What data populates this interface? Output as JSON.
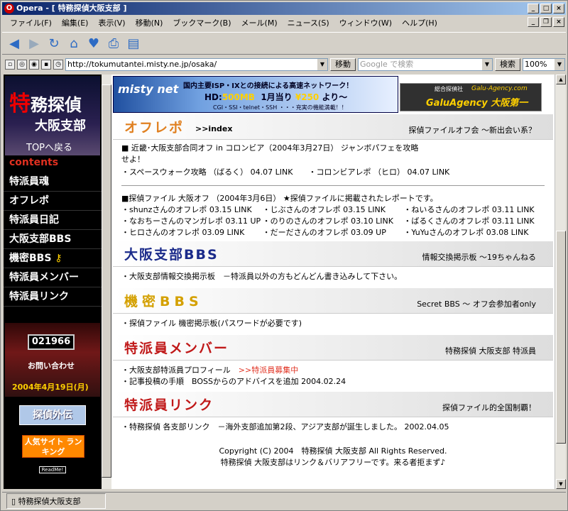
{
  "window": {
    "title": "Opera - [ 特務探偵大阪支部 ]"
  },
  "menu": [
    "ファイル(F)",
    "編集(E)",
    "表示(V)",
    "移動(N)",
    "ブックマーク(B)",
    "メール(M)",
    "ニュース(S)",
    "ウィンドウ(W)",
    "ヘルプ(H)"
  ],
  "address": {
    "url": "http://tokumutantei.misty.ne.jp/osaka/",
    "go_label": "移動",
    "search_placeholder": "Google で検索",
    "search_label": "検索",
    "zoom": "100%"
  },
  "status": {
    "text": "特務探偵大阪支部"
  },
  "sidebar": {
    "logo_big": "特",
    "logo_rest": "務探偵",
    "logo_sub": "大阪支部",
    "top_link": "TOPへ戻る",
    "contents_label": "contents",
    "items": [
      "特派員魂",
      "オフレポ",
      "特派員日記",
      "大阪支部BBS",
      "機密BBS",
      "特派員メンバー",
      "特派員リンク"
    ],
    "counter": "021966",
    "inquiry": "お問い合わせ",
    "date": "2004年4月19日(月)",
    "banner1": "探偵外伝",
    "banner2": "人気サイト ランキング",
    "readme": "ReadMe!"
  },
  "banners": {
    "misty": {
      "logo": "misty net",
      "line1": "国内主要ISP・IXとの接続による高速ネットワーク！",
      "line2a": "HD:",
      "line2b": "500MB",
      "line2c": "1月当り",
      "line2d": "¥250",
      "line2e": "より〜",
      "line3": "CGI・SSI・telnet・SSH ・・・充実の機能満載！！"
    },
    "galu": {
      "l1": "総合探偵社",
      "l2": "Galu-Agency.com",
      "l3": "GaluAgency 大阪第一"
    }
  },
  "sections": {
    "offrepo": {
      "title": "オフレポ",
      "sub": ">>index",
      "right": "探偵ファイルオフ会 〜新出会い系？",
      "p1": "■ 近畿･大阪支部合同オフ in コロンビア（2004年3月27日） ジャンボパフェを攻略せよ！",
      "p1_links": "・スペースウォーク攻略 （ばるく） 04.07 LINK　　・コロンビアレポ （ヒロ） 04.07 LINK",
      "p2": "■探偵ファイル 大阪オフ （2004年3月6日） ★探偵ファイルに掲載されたレポートです。",
      "reports": [
        [
          "・shunzさんのオフレポ 03.15 LINK",
          "・じぶさんのオフレポ 03.15 LINK",
          "・ねいるさんのオフレポ 03.11 LINK"
        ],
        [
          "・なおちーさんのマンガレポ 03.11 UP",
          "・のりのさんのオフレポ 03.10 LINK",
          "・ばるくさんのオフレポ 03.11 LINK"
        ],
        [
          "・ヒロさんのオフレポ 03.09 LINK",
          "・だーださんのオフレポ 03.09 UP",
          "・YuYuさんのオフレポ 03.08 LINK"
        ]
      ]
    },
    "bbs": {
      "title": "大阪支部BBS",
      "right": "情報交換掲示板 〜19ちゃんねる",
      "body": "・大阪支部情報交換掲示板　－特派員以外の方もどんどん書き込みして下さい。"
    },
    "secret": {
      "title": "機密BBS",
      "right": "Secret BBS 〜 オフ会参加者only",
      "body": "・探偵ファイル 機密掲示板(パスワードが必要です)"
    },
    "members": {
      "title": "特派員メンバー",
      "right": "特務探偵 大阪支部 特派員",
      "body1a": "・大阪支部特派員プロフィール　",
      "body1b": ">>特派員募集中",
      "body2": "・記事投稿の手順　BOSSからのアドバイスを追加 2004.02.24"
    },
    "links": {
      "title": "特派員リンク",
      "right": "探偵ファイル的全国制覇！",
      "body": "・特務探偵 各支部リンク　－海外支部追加第2段、アジア支部が誕生しました。 2002.04.05"
    }
  },
  "footer": {
    "line1": "Copyright (C) 2004　特務探偵 大阪支部 All Rights Reserved.",
    "line2": "特務探偵 大阪支部はリンク＆バリアフリーです。来る者拒まず♪"
  }
}
